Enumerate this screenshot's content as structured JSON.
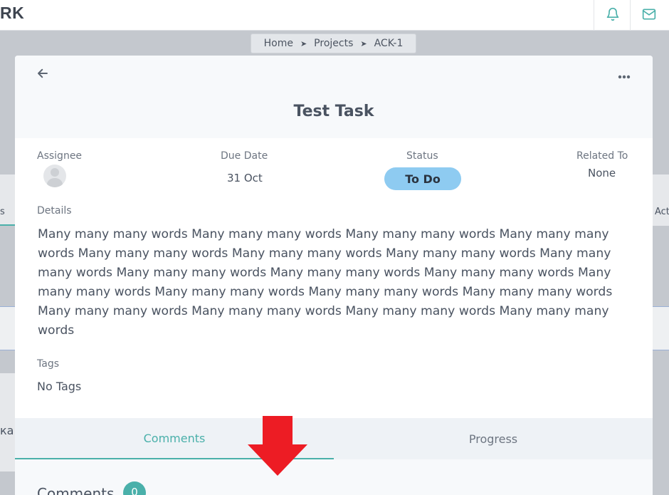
{
  "header": {
    "brand_fragment": "RK",
    "bell_icon": "bell-icon",
    "mail_icon": "mail-icon",
    "accent_color": "#4ab0aa"
  },
  "breadcrumb": {
    "items": [
      "Home",
      "Projects",
      "ACK-1"
    ],
    "separator": "➤"
  },
  "background_page": {
    "left_fragment_1": "s",
    "left_fragment_2": "ка",
    "right_fragment": "Act"
  },
  "task": {
    "title": "Test Task",
    "back_icon": "arrow-left-icon",
    "more_icon": "more-horizontal-icon",
    "assignee_label": "Assignee",
    "due_date_label": "Due Date",
    "due_date_value": "31 Oct",
    "status_label": "Status",
    "status_value": "To Do",
    "status_color": "#8ecbf1",
    "related_label": "Related To",
    "related_value": "None",
    "details_label": "Details",
    "details_text": "Many many many words Many many many words Many many many words Many many many words Many many many words Many many many words Many many many words Many many many words Many many many words Many many many words Many many many words Many many many words Many many many words Many many many words Many many many words Many many many words Many many many words Many many many words Many many many words",
    "tags_label": "Tags",
    "tags_value": "No Tags"
  },
  "tabs": {
    "comments": "Comments",
    "progress": "Progress",
    "active": "Comments"
  },
  "comments": {
    "heading": "Comments",
    "count": "0"
  },
  "annotation": {
    "arrow_color": "#ed1c24"
  }
}
